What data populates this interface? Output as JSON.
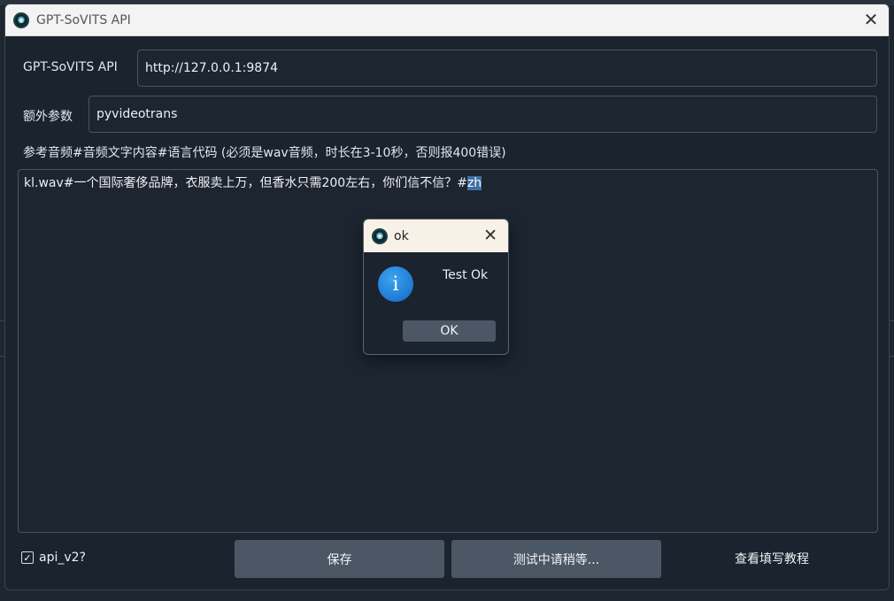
{
  "window": {
    "title": "GPT-SoVITS API",
    "close_symbol": "✕",
    "icon": "app-logo-icon"
  },
  "form": {
    "api_label": "GPT-SoVITS API",
    "api_value": "http://127.0.0.1:9874",
    "extra_label": "额外参数",
    "extra_value": "pyvideotrans",
    "ref_label": "参考音频#音频文字内容#语言代码 (必须是wav音频，时长在3-10秒，否则报400错误)",
    "ref_text_before": "kl.wav#一个国际奢侈品牌，衣服卖上万，但香水只需200左右，你们信不信？#",
    "ref_text_selected": "zh"
  },
  "footer": {
    "checkbox_label": "api_v2?",
    "checkbox_checked": true,
    "checkbox_mark": "✓",
    "save_label": "保存",
    "test_label": "测试中请稍等...",
    "tutorial_label": "查看填写教程"
  },
  "dialog": {
    "title": "ok",
    "close_symbol": "✕",
    "message": "Test Ok",
    "ok_label": "OK",
    "info_symbol": "i",
    "icon": "info-icon"
  },
  "colors": {
    "window_bg": "#1b232e",
    "button_bg": "#4c5766",
    "selection": "#3d6fa3",
    "info_blue": "#1466c7"
  }
}
